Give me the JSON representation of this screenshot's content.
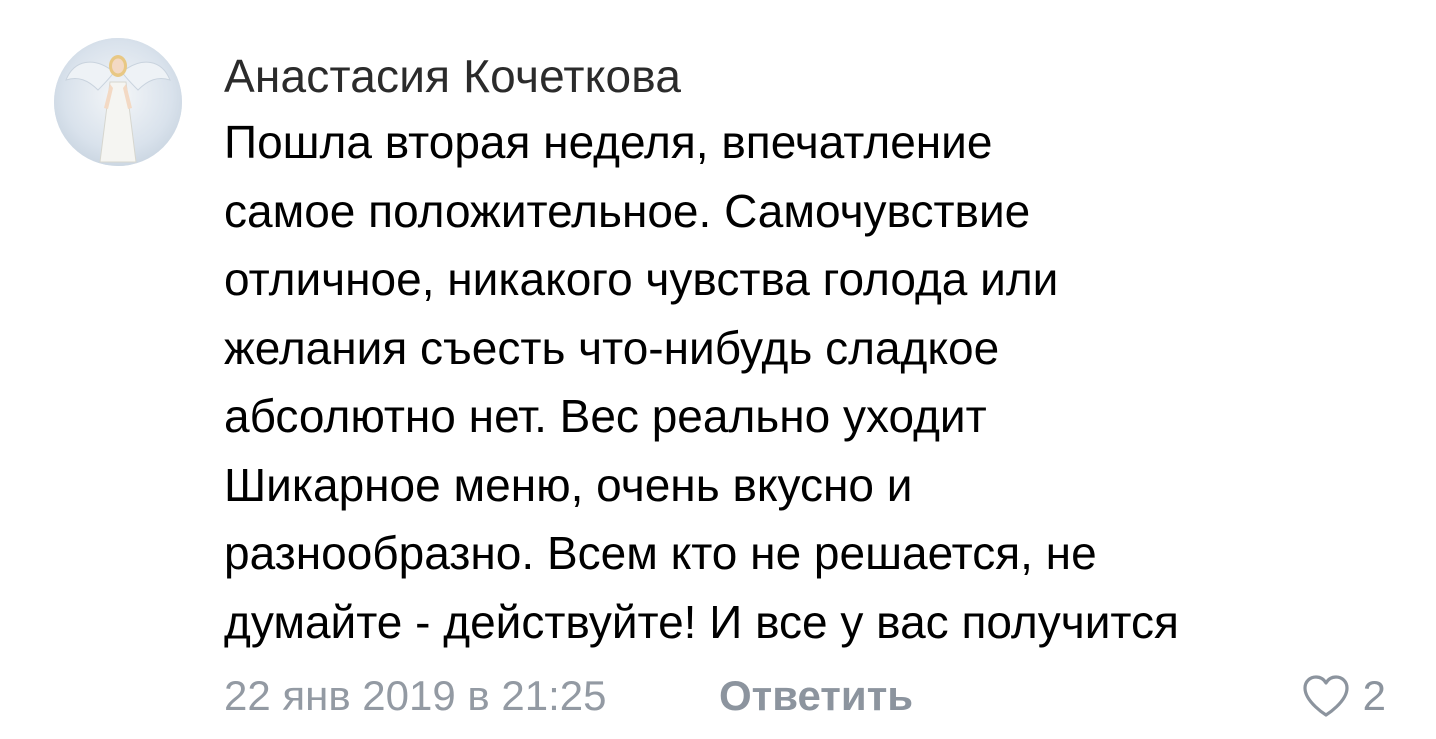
{
  "comment": {
    "author": "Анастасия Кочеткова",
    "text_lines": [
      "Пошла вторая неделя, впечатление",
      "самое положительное. Самочувствие",
      "отличное, никакого чувства голода или",
      "желания съесть что-нибудь сладкое",
      "абсолютно нет. Вес реально уходит",
      "Шикарное меню, очень вкусно и",
      "разнообразно. Всем кто не решается, не",
      "думайте - действуйте! И все у вас получится"
    ],
    "date": "22 янв 2019 в 21:25",
    "reply_label": "Ответить",
    "like_count": "2",
    "like_icon": "heart-outline-icon",
    "avatar_icon": "angel-avatar"
  },
  "colors": {
    "author": "#2b2b2b",
    "text": "#000000",
    "meta": "#939aa3",
    "action": "#8c949e"
  }
}
